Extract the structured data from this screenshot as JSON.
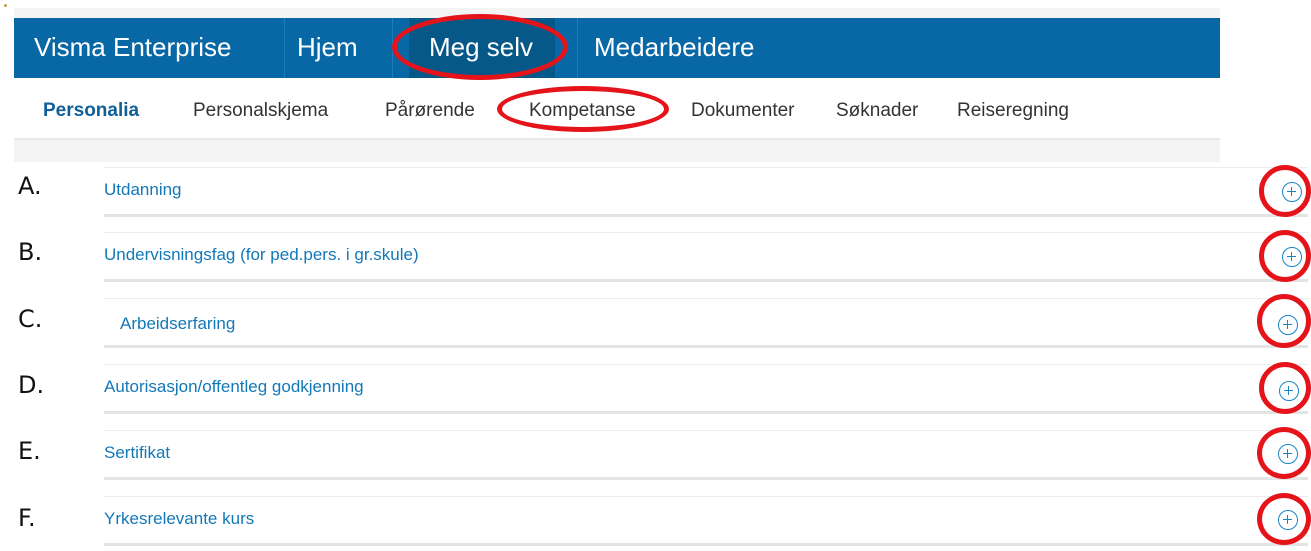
{
  "app": {
    "brand": "Visma Enterprise",
    "nav": [
      "Hjem",
      "Meg selv",
      "Medarbeidere"
    ]
  },
  "subnav": [
    "Personalia",
    "Personalskjema",
    "Pårørende",
    "Kompetanse",
    "Dokumenter",
    "Søknader",
    "Reiseregning"
  ],
  "sections": [
    {
      "letter": "A.",
      "title": "Utdanning",
      "icon": "add-circle-icon"
    },
    {
      "letter": "B.",
      "title": "Undervisningsfag (for ped.pers. i gr.skule)",
      "icon": "add-circle-icon"
    },
    {
      "letter": "C.",
      "title": "Arbeidserfaring",
      "icon": "add-circle-icon"
    },
    {
      "letter": "D.",
      "title": "Autorisasjon/offentleg godkjenning",
      "icon": "add-circle-icon"
    },
    {
      "letter": "E.",
      "title": "Sertifikat",
      "icon": "add-circle-icon"
    },
    {
      "letter": "F.",
      "title": "Yrkesrelevante kurs",
      "icon": "add-circle-icon"
    }
  ],
  "colors": {
    "nav_bg": "#0868a6",
    "nav_active_bg": "#065889",
    "link_blue": "#1278b8",
    "annotation_red": "#e4141a"
  }
}
